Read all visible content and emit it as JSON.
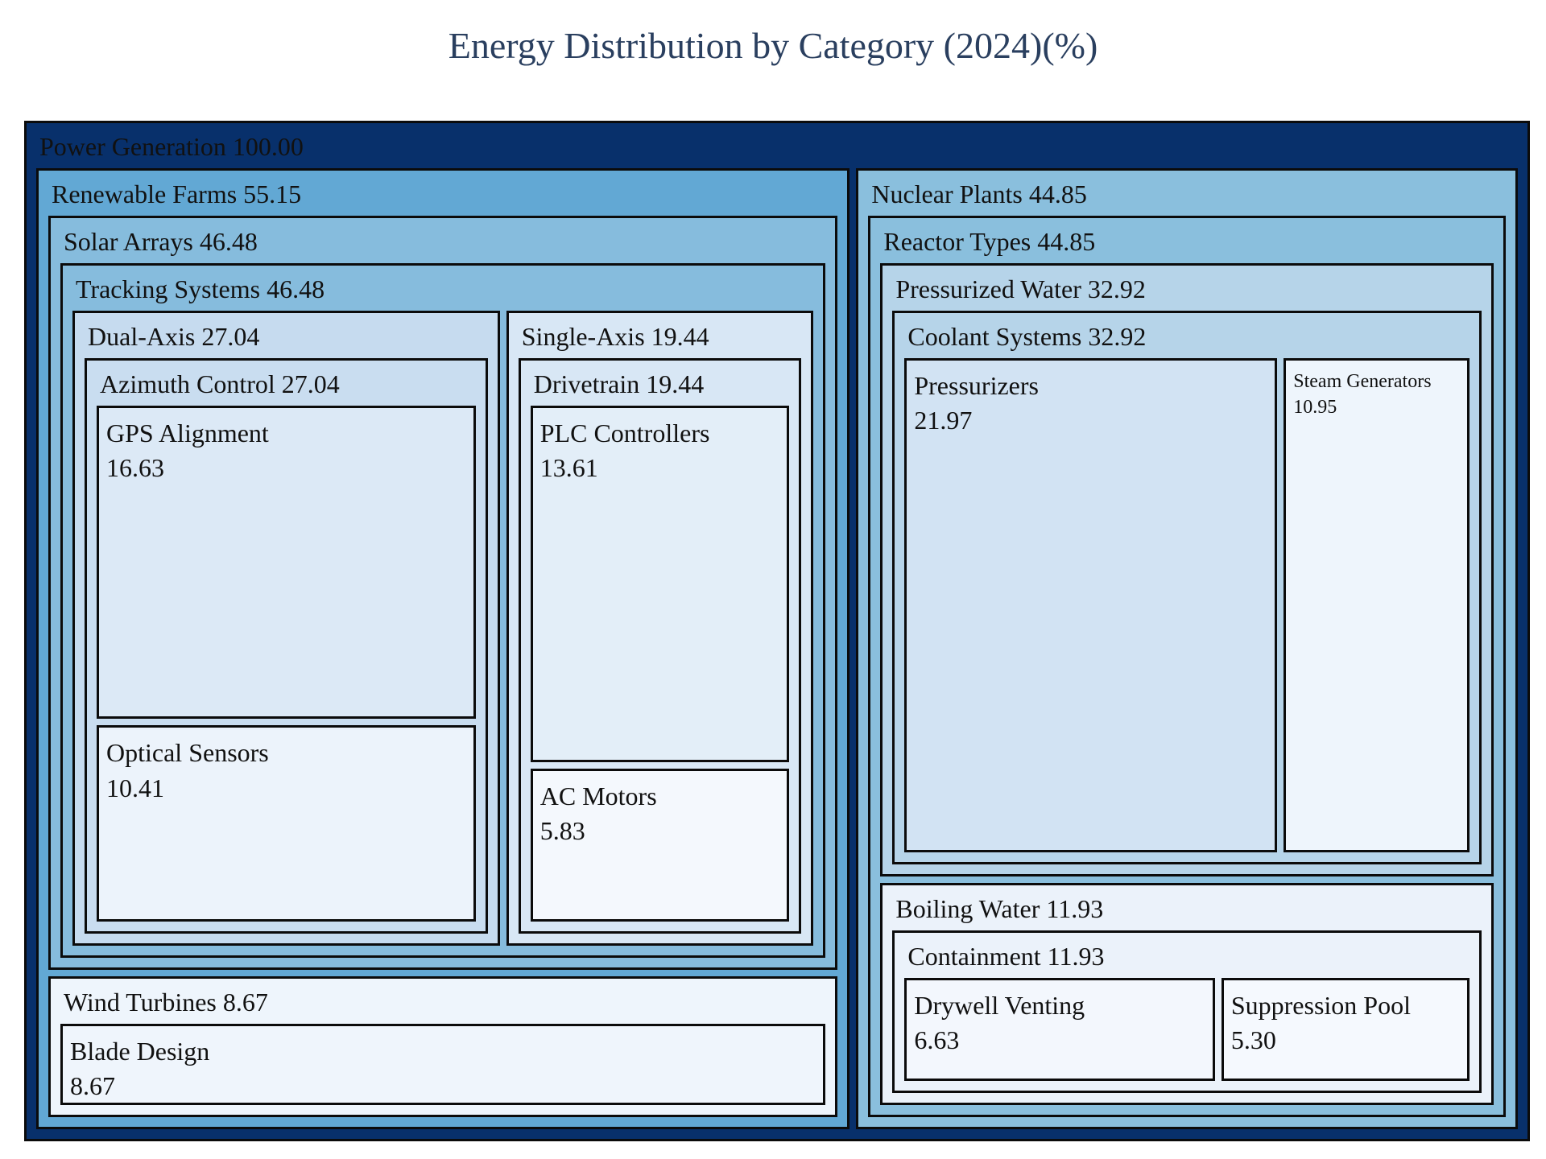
{
  "chart_data": {
    "type": "treemap",
    "title": "Energy Distribution by Category (2024)(%)",
    "nodes": [
      {
        "id": "power-generation",
        "name": "Power Generation",
        "value": 100.0,
        "display": "100.00",
        "parent": null,
        "color": "#08306b"
      },
      {
        "id": "renewable-farms",
        "name": "Renewable Farms",
        "value": 55.15,
        "display": "55.15",
        "parent": "power-generation",
        "color": "#62a8d4"
      },
      {
        "id": "nuclear-plants",
        "name": "Nuclear Plants",
        "value": 44.85,
        "display": "44.85",
        "parent": "power-generation",
        "color": "#8abfdd"
      },
      {
        "id": "solar-arrays",
        "name": "Solar Arrays",
        "value": 46.48,
        "display": "46.48",
        "parent": "renewable-farms",
        "color": "#86bcdd"
      },
      {
        "id": "wind-turbines",
        "name": "Wind Turbines",
        "value": 8.67,
        "display": "8.67",
        "parent": "renewable-farms",
        "color": "#eef5fc"
      },
      {
        "id": "tracking-systems",
        "name": "Tracking Systems",
        "value": 46.48,
        "display": "46.48",
        "parent": "solar-arrays",
        "color": "#86bcdd"
      },
      {
        "id": "dual-axis",
        "name": "Dual-Axis",
        "value": 27.04,
        "display": "27.04",
        "parent": "tracking-systems",
        "color": "#c6dbef"
      },
      {
        "id": "single-axis",
        "name": "Single-Axis",
        "value": 19.44,
        "display": "19.44",
        "parent": "tracking-systems",
        "color": "#d8e7f5"
      },
      {
        "id": "azimuth-control",
        "name": "Azimuth Control",
        "value": 27.04,
        "display": "27.04",
        "parent": "dual-axis",
        "color": "#c9ddf0"
      },
      {
        "id": "gps-alignment",
        "name": "GPS Alignment",
        "value": 16.63,
        "display": "16.63",
        "parent": "azimuth-control",
        "color": "#dce9f6"
      },
      {
        "id": "optical-sensors",
        "name": "Optical Sensors",
        "value": 10.41,
        "display": "10.41",
        "parent": "azimuth-control",
        "color": "#ecf3fb"
      },
      {
        "id": "drivetrain",
        "name": "Drivetrain",
        "value": 19.44,
        "display": "19.44",
        "parent": "single-axis",
        "color": "#d8e7f5"
      },
      {
        "id": "plc-controllers",
        "name": "PLC Controllers",
        "value": 13.61,
        "display": "13.61",
        "parent": "drivetrain",
        "color": "#e3eef8"
      },
      {
        "id": "ac-motors",
        "name": "AC Motors",
        "value": 5.83,
        "display": "5.83",
        "parent": "drivetrain",
        "color": "#f4f8fd"
      },
      {
        "id": "blade-design",
        "name": "Blade Design",
        "value": 8.67,
        "display": "8.67",
        "parent": "wind-turbines",
        "color": "#eff5fc"
      },
      {
        "id": "reactor-types",
        "name": "Reactor Types",
        "value": 44.85,
        "display": "44.85",
        "parent": "nuclear-plants",
        "color": "#8abfdd"
      },
      {
        "id": "pressurized-water",
        "name": "Pressurized Water",
        "value": 32.92,
        "display": "32.92",
        "parent": "reactor-types",
        "color": "#b6d4e9"
      },
      {
        "id": "boiling-water",
        "name": "Boiling Water",
        "value": 11.93,
        "display": "11.93",
        "parent": "reactor-types",
        "color": "#ebf2fa"
      },
      {
        "id": "coolant-systems",
        "name": "Coolant Systems",
        "value": 32.92,
        "display": "32.92",
        "parent": "pressurized-water",
        "color": "#b6d4e9"
      },
      {
        "id": "pressurizers",
        "name": "Pressurizers",
        "value": 21.97,
        "display": "21.97",
        "parent": "coolant-systems",
        "color": "#d2e3f3"
      },
      {
        "id": "steam-generators",
        "name": "Steam Generators",
        "value": 10.95,
        "display": "10.95",
        "parent": "coolant-systems",
        "color": "#eef5fc"
      },
      {
        "id": "containment",
        "name": "Containment",
        "value": 11.93,
        "display": "11.93",
        "parent": "boiling-water",
        "color": "#ebf2fa"
      },
      {
        "id": "drywell-venting",
        "name": "Drywell Venting",
        "value": 6.63,
        "display": "6.63",
        "parent": "containment",
        "color": "#f3f7fd"
      },
      {
        "id": "suppression-pool",
        "name": "Suppression Pool",
        "value": 5.3,
        "display": "5.30",
        "parent": "containment",
        "color": "#f5f9fe"
      }
    ]
  }
}
